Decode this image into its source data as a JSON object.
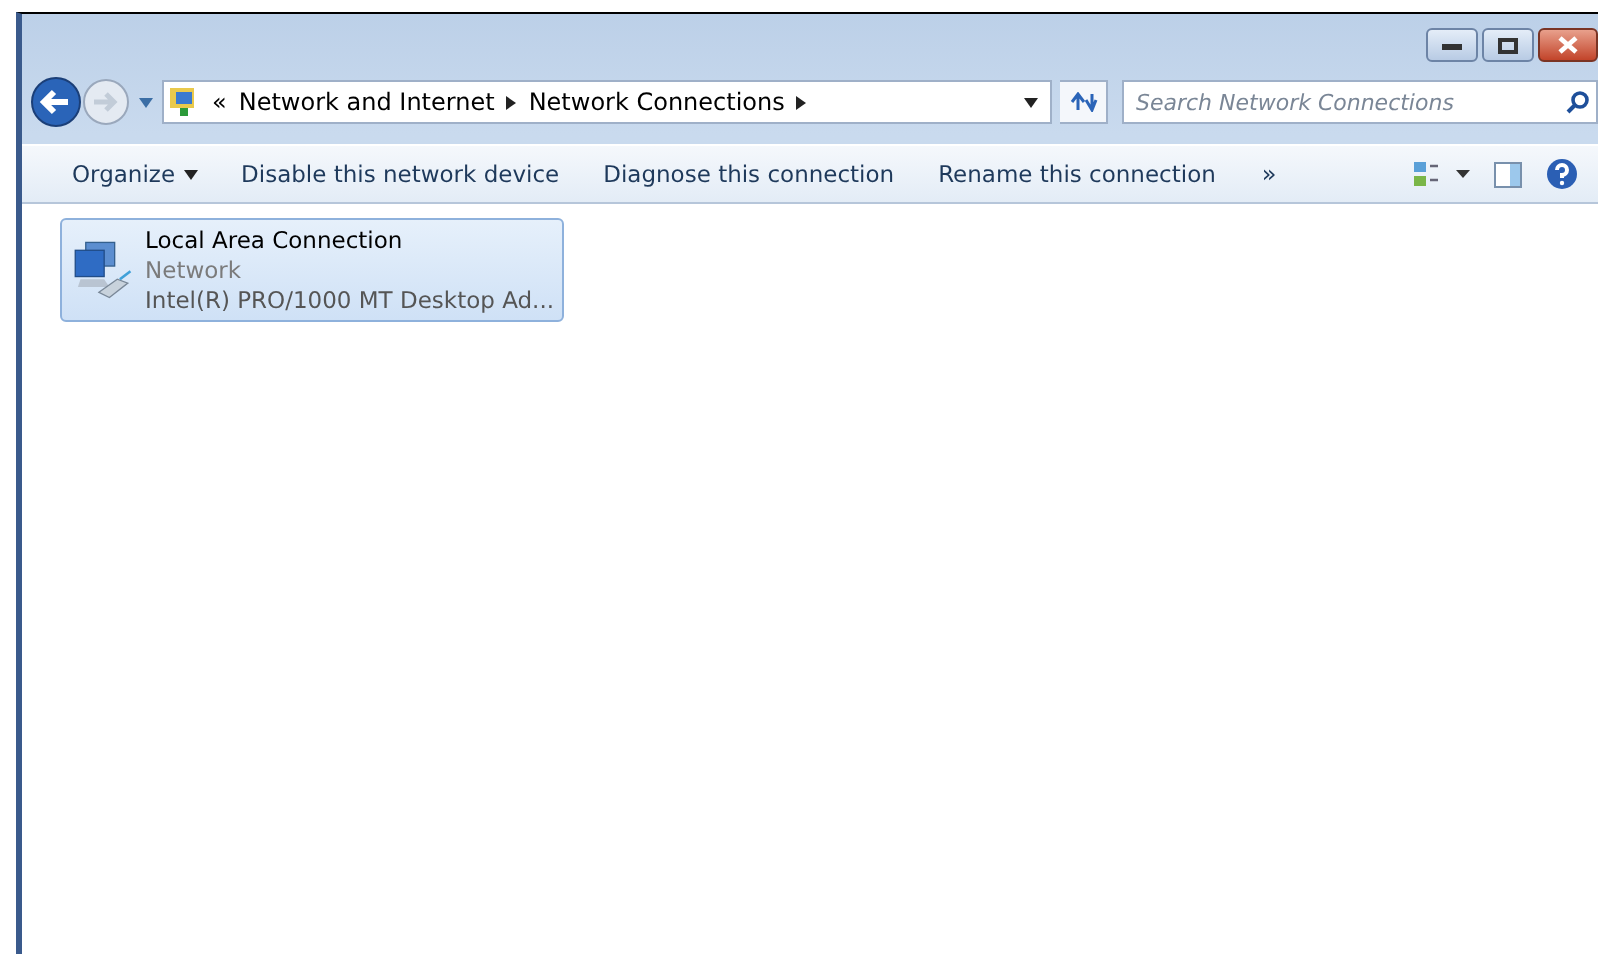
{
  "address": {
    "overflow": "«",
    "crumbs": [
      "Network and Internet",
      "Network Connections"
    ]
  },
  "search": {
    "placeholder": "Search Network Connections"
  },
  "toolbar": {
    "items": [
      {
        "label": "Organize",
        "kind": "menu"
      },
      {
        "label": "Disable this network device",
        "kind": "plain"
      },
      {
        "label": "Diagnose this connection",
        "kind": "plain"
      },
      {
        "label": "Rename this connection",
        "kind": "plain"
      }
    ],
    "overflow": "»"
  },
  "connections": [
    {
      "name": "Local Area Connection",
      "status": "Network",
      "device": "Intel(R) PRO/1000 MT Desktop Ad...",
      "selected": true
    }
  ]
}
